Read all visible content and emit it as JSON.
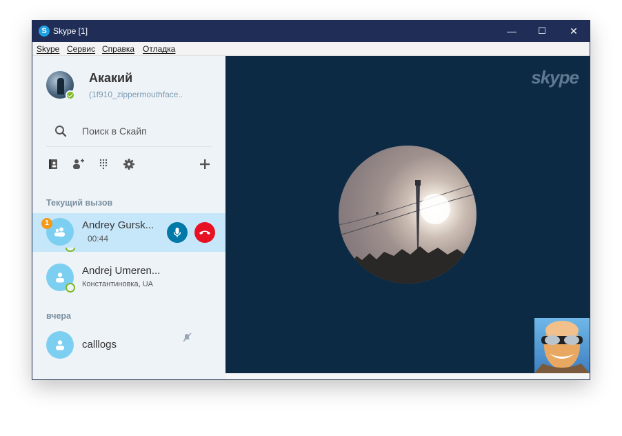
{
  "window": {
    "title": "Skype [1]",
    "controls": {
      "minimize": "—",
      "maximize": "☐",
      "close": "✕"
    }
  },
  "menu": [
    "Skype",
    "Сервис",
    "Справка",
    "Отладка"
  ],
  "profile": {
    "name": "Акакий",
    "mood": "(1f910_zippermouthface.."
  },
  "search": {
    "label": "Поиск в Скайп"
  },
  "sections": {
    "current_call": "Текущий вызов",
    "yesterday": "вчера"
  },
  "current_call": {
    "name": "Andrey Gursk...",
    "duration": "00:44",
    "badge": "1"
  },
  "contacts": [
    {
      "name": "Andrej Umeren...",
      "location": "Константиновка, UA"
    },
    {
      "name": "calllogs"
    }
  ],
  "video": {
    "watermark": "skype"
  },
  "colors": {
    "titlebar": "#1f2d57",
    "accent": "#00aff0",
    "mic": "#0078a8",
    "hangup": "#e81123",
    "selected_row": "#c6e7fa",
    "video_bg": "#0c2a44"
  }
}
